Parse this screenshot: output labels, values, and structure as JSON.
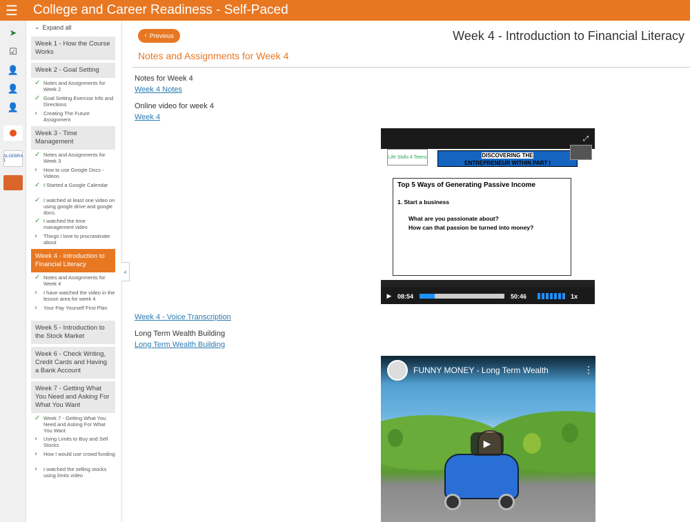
{
  "app": {
    "title": "College and Career Readiness - Self-Paced",
    "menu_icon": "☰"
  },
  "rail": {
    "logo2": "ALGEBRA 1"
  },
  "sidebar": {
    "expand_all": "Expand all",
    "items": [
      {
        "kind": "week",
        "label": "Week 1 - How the Course Works"
      },
      {
        "kind": "week",
        "label": "Week 2 - Goal Setting"
      },
      {
        "kind": "sub",
        "mark": "check",
        "label": "Notes and Assignments for Week 2"
      },
      {
        "kind": "sub",
        "mark": "check",
        "label": "Goal Setting Exercise Info and Directions"
      },
      {
        "kind": "sub",
        "mark": "chev",
        "label": "Creating The Future Assignment"
      },
      {
        "kind": "week",
        "label": "Week 3 - Time Management"
      },
      {
        "kind": "sub",
        "mark": "check",
        "label": "Notes and Assignments for Week 3"
      },
      {
        "kind": "sub",
        "mark": "chev",
        "label": "How to use Google Docs - Videos"
      },
      {
        "kind": "sub",
        "mark": "check",
        "label": "I Started a Google Calendar"
      },
      {
        "kind": "sub",
        "mark": "check",
        "label": "I watched at least one video on using google drive and google docs."
      },
      {
        "kind": "sub",
        "mark": "check",
        "label": "I watched the time management video"
      },
      {
        "kind": "sub",
        "mark": "chev",
        "label": "Things I love to procrastinate about"
      },
      {
        "kind": "week",
        "label": "Week 4 - Introduction to Financial Literacy",
        "active": true
      },
      {
        "kind": "sub",
        "mark": "check",
        "label": "Notes and Assignments for Week 4"
      },
      {
        "kind": "sub",
        "mark": "chev",
        "label": "I have watched the video in the lesson area for week 4"
      },
      {
        "kind": "sub",
        "mark": "chev",
        "label": "Your Pay Yourself First Plan"
      },
      {
        "kind": "week",
        "label": "Week 5 - Introduction to the Stock Market"
      },
      {
        "kind": "week",
        "label": "Week 6 - Check Writing, Credit Cards and Having a Bank Account"
      },
      {
        "kind": "week",
        "label": "Week 7 - Getting What You Need and Asking For What You Want"
      },
      {
        "kind": "sub",
        "mark": "check",
        "label": "Week 7 - Getting What You Need and Asking For What You Want"
      },
      {
        "kind": "sub",
        "mark": "chev",
        "label": "Using Limits to Buy and Sell Stocks"
      },
      {
        "kind": "sub",
        "mark": "chev",
        "label": "How I would use crowd funding"
      },
      {
        "kind": "sub",
        "mark": "chev",
        "label": "I watched the selling stocks using limits video"
      }
    ]
  },
  "main": {
    "previous_label": "Previous",
    "week_title": "Week 4 - Introduction to Financial Literacy",
    "section_title": "Notes and Assignments for Week 4",
    "notes_label": "Notes for Week 4",
    "notes_link": "Week 4 Notes",
    "video_label": "Online video for week 4",
    "video_link": "Week 4",
    "transcription_link": "Week 4 - Voice Transcription",
    "wealth_label": "Long Term Wealth Building",
    "wealth_link": "Long Term Wealth Building"
  },
  "video1": {
    "logo_text": "Life Skills 4 Teens",
    "banner_line1": "DISCOVERING THE",
    "banner_line2": "ENTREPRENEUR WITHIN PART I",
    "box_title": "Top 5 Ways of Generating Passive Income",
    "step1": "1.   Start a business",
    "q1": "What are you passionate about?",
    "q2": "How can that passion be turned into money?",
    "time_current": "08:54",
    "time_total": "50:46",
    "speed": "1x",
    "progress": 0.175
  },
  "video2": {
    "title": "FUNNY MONEY - Long Term Wealth"
  }
}
